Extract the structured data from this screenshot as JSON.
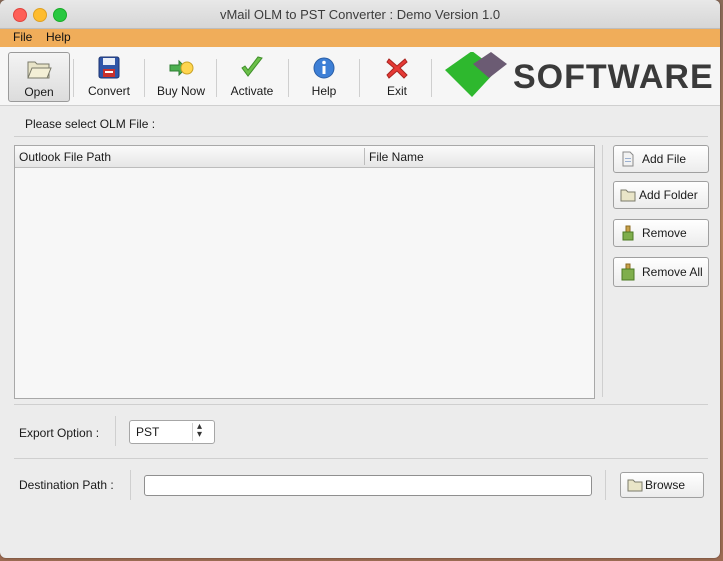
{
  "window": {
    "title": "vMail OLM to PST Converter : Demo Version 1.0"
  },
  "menu": {
    "file": "File",
    "help": "Help"
  },
  "toolbar": {
    "open": "Open",
    "convert": "Convert",
    "buy_now": "Buy Now",
    "activate": "Activate",
    "help": "Help",
    "exit": "Exit"
  },
  "brand": {
    "logo_text": "SOFTWARE",
    "accent_green": "#2eb82e",
    "accent_purple": "#6b5b73"
  },
  "file_section": {
    "label": "Please select OLM File :",
    "columns": [
      "Outlook File Path",
      "File Name"
    ],
    "rows": []
  },
  "side_buttons": {
    "add_file": "Add File",
    "add_folder": "Add Folder",
    "remove": "Remove",
    "remove_all": "Remove All"
  },
  "export": {
    "label": "Export Option :",
    "selected": "PST"
  },
  "destination": {
    "label": "Destination Path :",
    "value": "",
    "browse": "Browse"
  },
  "colors": {
    "menubar": "#f0ad5a",
    "window_bg": "#ececec"
  }
}
